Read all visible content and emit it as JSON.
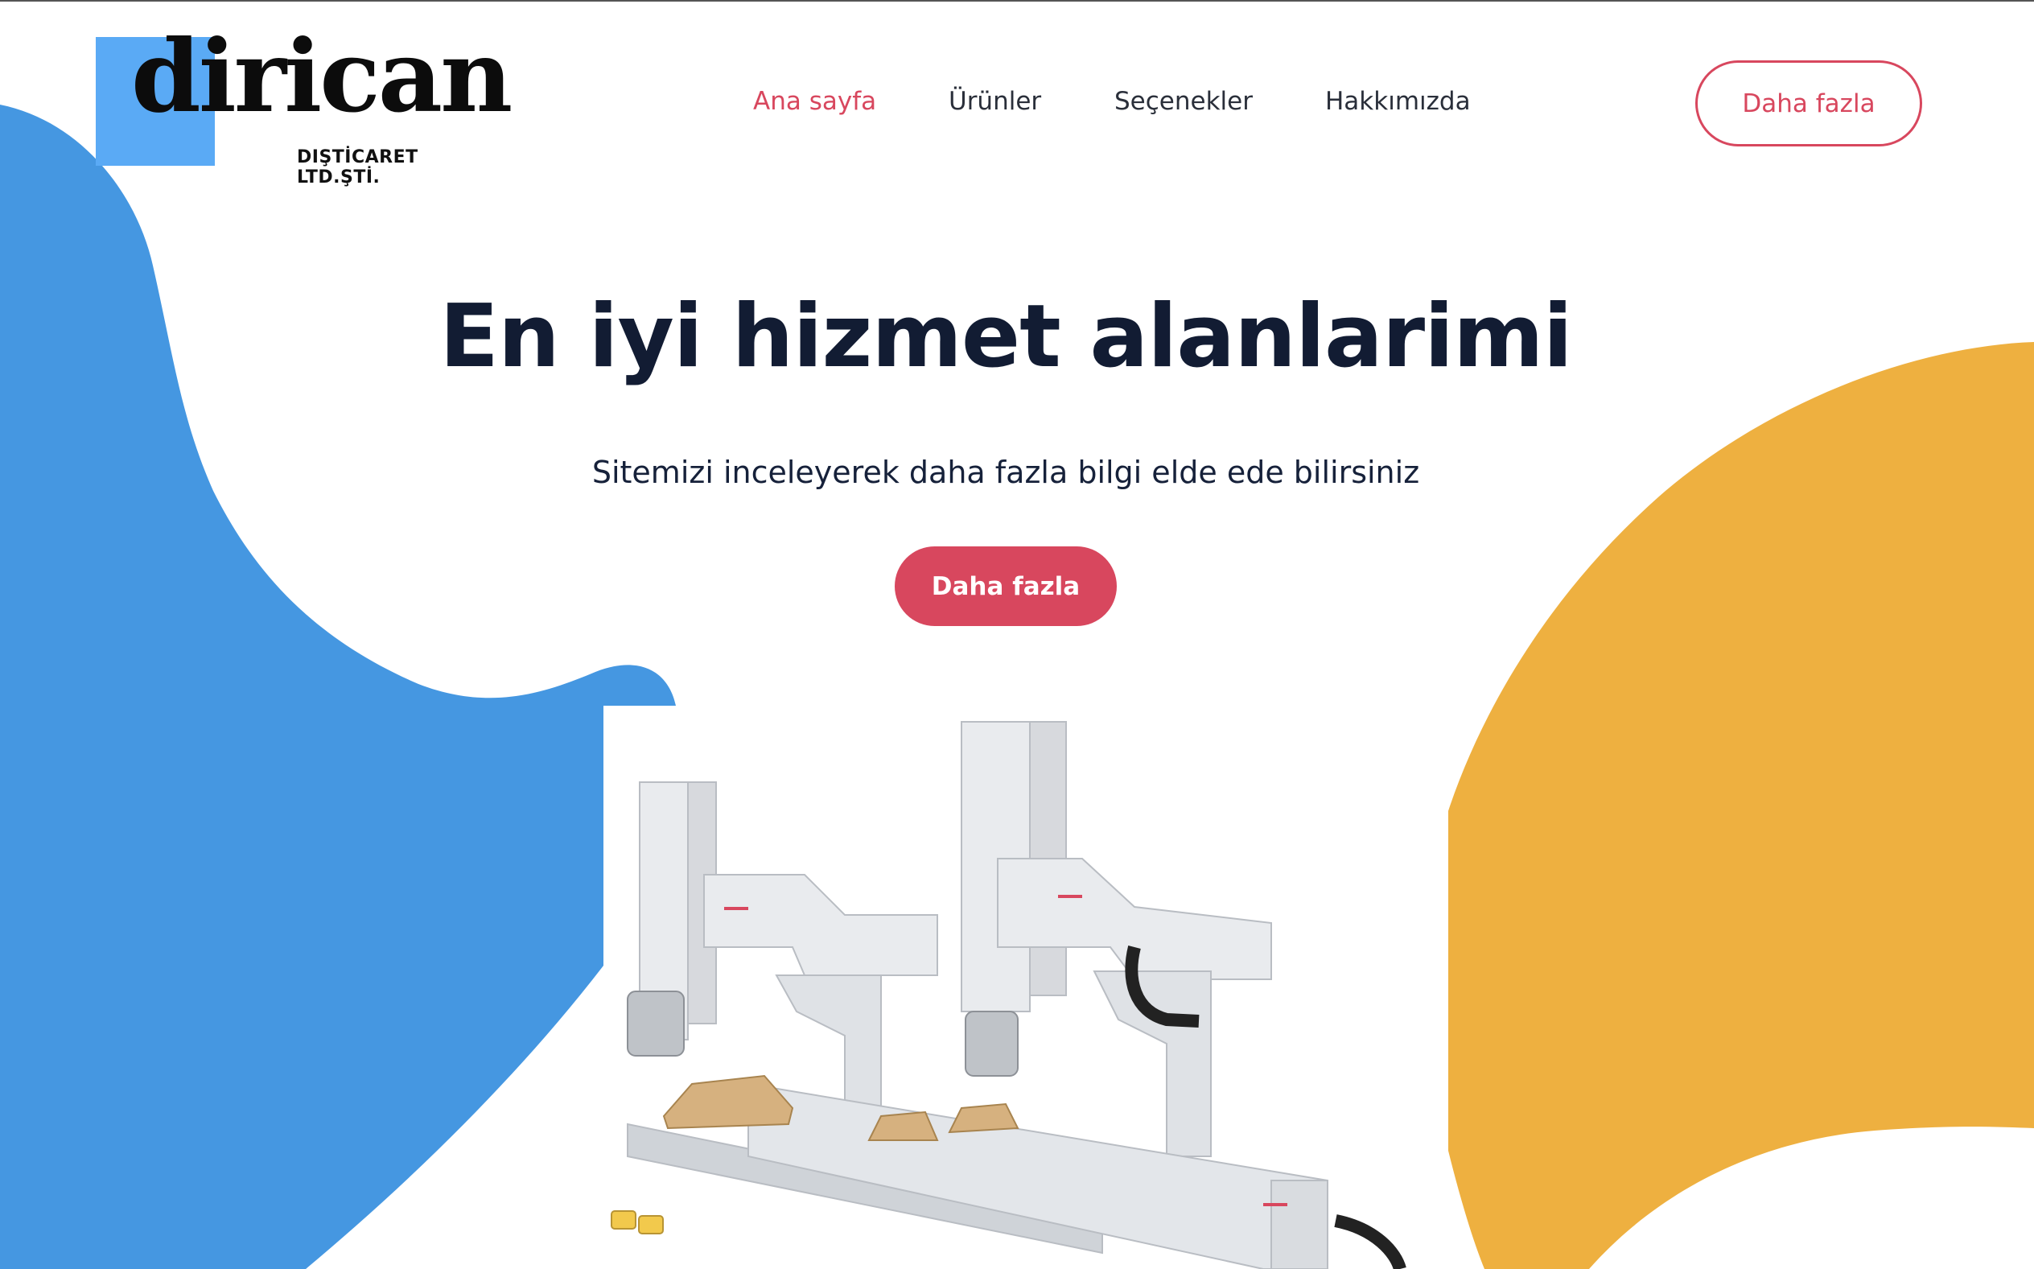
{
  "brand": {
    "logo_word": "dirican",
    "logo_sub": "DIŞTİCARET LTD.ŞTİ."
  },
  "nav": {
    "items": [
      {
        "label": "Ana sayfa",
        "active": true
      },
      {
        "label": "Ürünler",
        "active": false
      },
      {
        "label": "Seçenekler",
        "active": false
      },
      {
        "label": "Hakkımızda",
        "active": false
      }
    ],
    "cta_label": "Daha fazla"
  },
  "hero": {
    "title": "En iyi hizmet alanlarimi",
    "subtitle": "Sitemizi inceleyerek daha fazla bilgi elde ede bilirsiniz",
    "cta_label": "Daha fazla"
  },
  "colors": {
    "accent": "#d8475e",
    "blue_blob": "#4597e1",
    "yellow_blob": "#eeb040",
    "logo_square": "#5aaaf5",
    "text_dark": "#121c33"
  },
  "icons": {
    "product": "cnc-machine-image"
  }
}
